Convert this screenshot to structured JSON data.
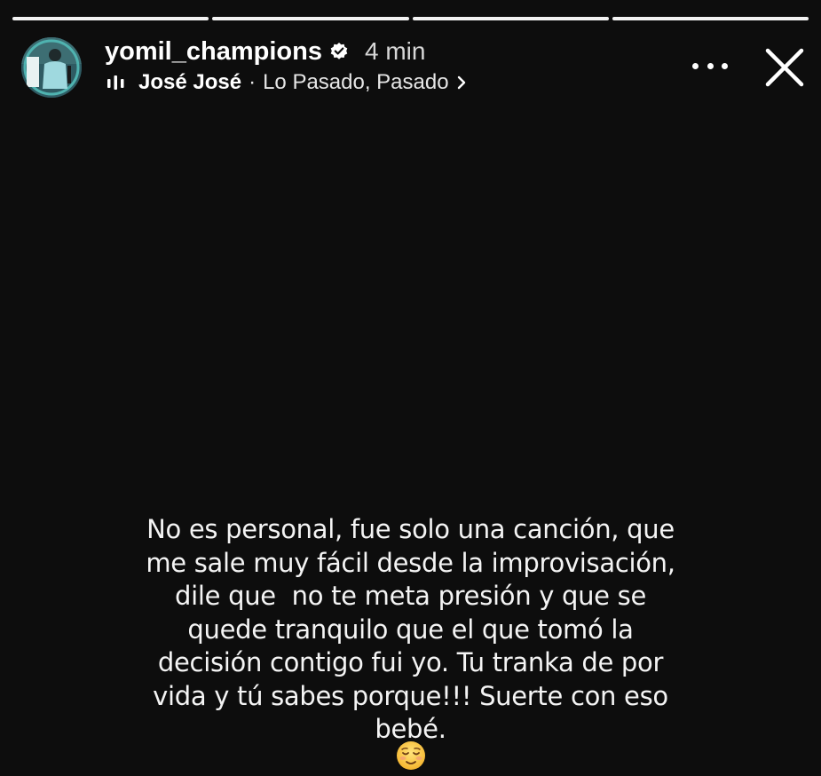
{
  "story": {
    "progress_segments": 4,
    "progress_color": "#f2f2f2",
    "background_color": "#0d0d0d"
  },
  "header": {
    "avatar_icon": "avatar-image",
    "username": "yomil_champions",
    "verified_icon": "verified-badge-icon",
    "time": "4 min",
    "music": {
      "icon": "audio-bars-icon",
      "artist": "José José",
      "separator": "·",
      "song": "Lo Pasado, Pasado",
      "chevron_icon": "chevron-right-icon"
    },
    "more_icon": "more-options-icon",
    "close_icon": "close-icon"
  },
  "caption": {
    "lines": [
      "No es personal, fue solo una canción, que",
      "me sale muy fácil desde la improvisación,",
      "dile que  no te meta presión y que se",
      "quede tranquilo que el que tomó la",
      "decisión contigo fui yo. Tu tranka de por",
      "vida y tú sabes porque!!! Suerte con eso",
      "bebé."
    ],
    "emoji": "relieved-face-emoji"
  }
}
